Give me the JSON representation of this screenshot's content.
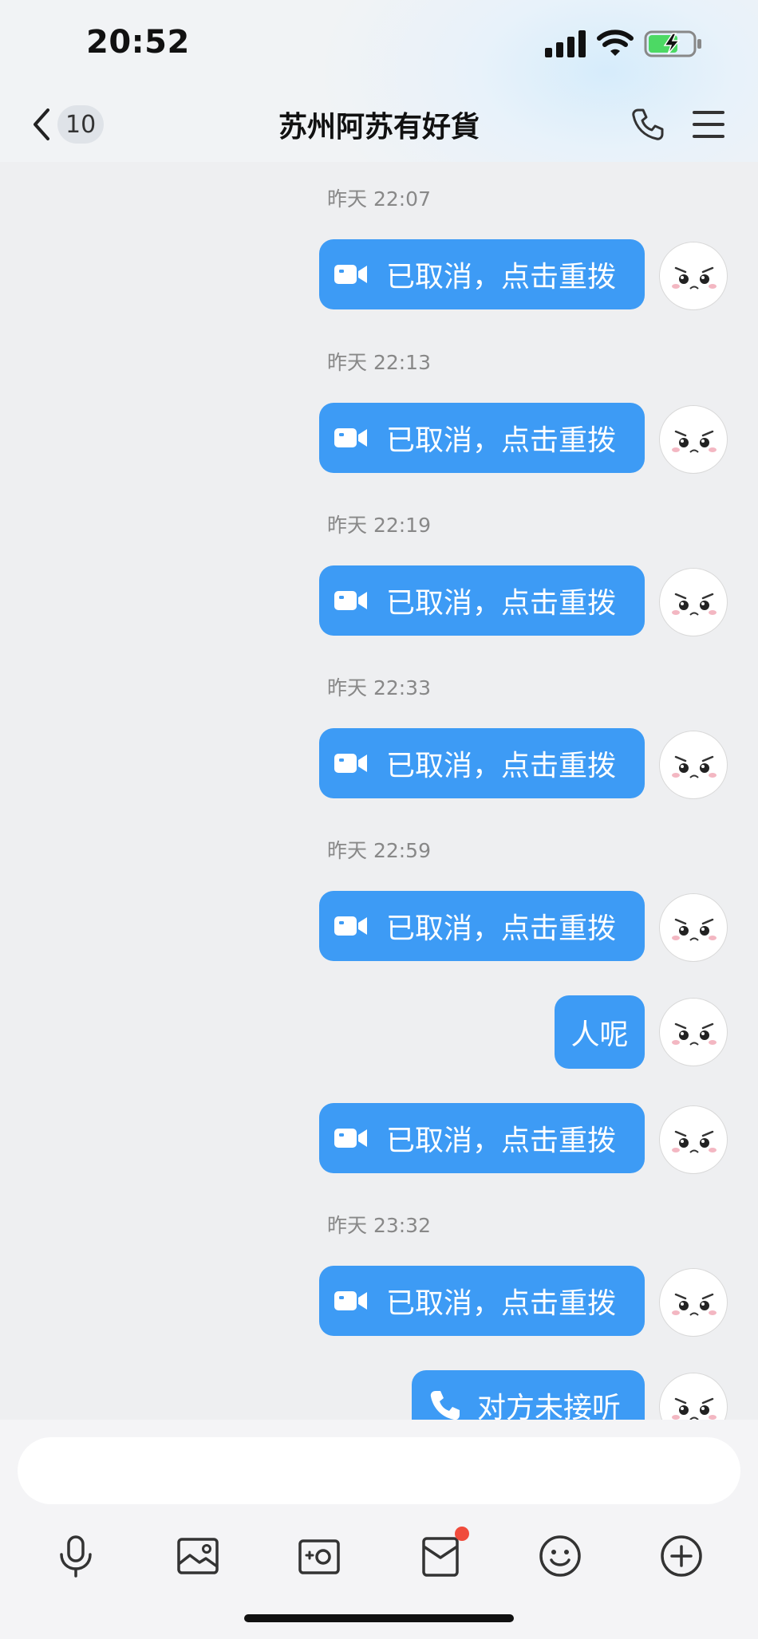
{
  "status_bar": {
    "time": "20:52"
  },
  "header": {
    "back_count": "10",
    "title": "苏州阿苏有好貨"
  },
  "messages": {
    "t1": "昨天 22:07",
    "m1": "已取消，点击重拨",
    "t2": "昨天 22:13",
    "m2": "已取消，点击重拨",
    "t3": "昨天 22:19",
    "m3": "已取消，点击重拨",
    "t4": "昨天 22:33",
    "m4": "已取消，点击重拨",
    "t5": "昨天 22:59",
    "m5": "已取消，点击重拨",
    "m6": "人呢",
    "m7": "已取消，点击重拨",
    "t6": "昨天 23:32",
    "m8": "已取消，点击重拨",
    "m9": "对方未接听"
  },
  "input": {
    "placeholder": ""
  },
  "toolbar": [
    "microphone-icon",
    "image-icon",
    "camera-icon",
    "red-packet-icon",
    "emoji-icon",
    "plus-icon"
  ],
  "colors": {
    "bubble": "#3d9bf5",
    "badge_dot": "#f04b3c"
  }
}
